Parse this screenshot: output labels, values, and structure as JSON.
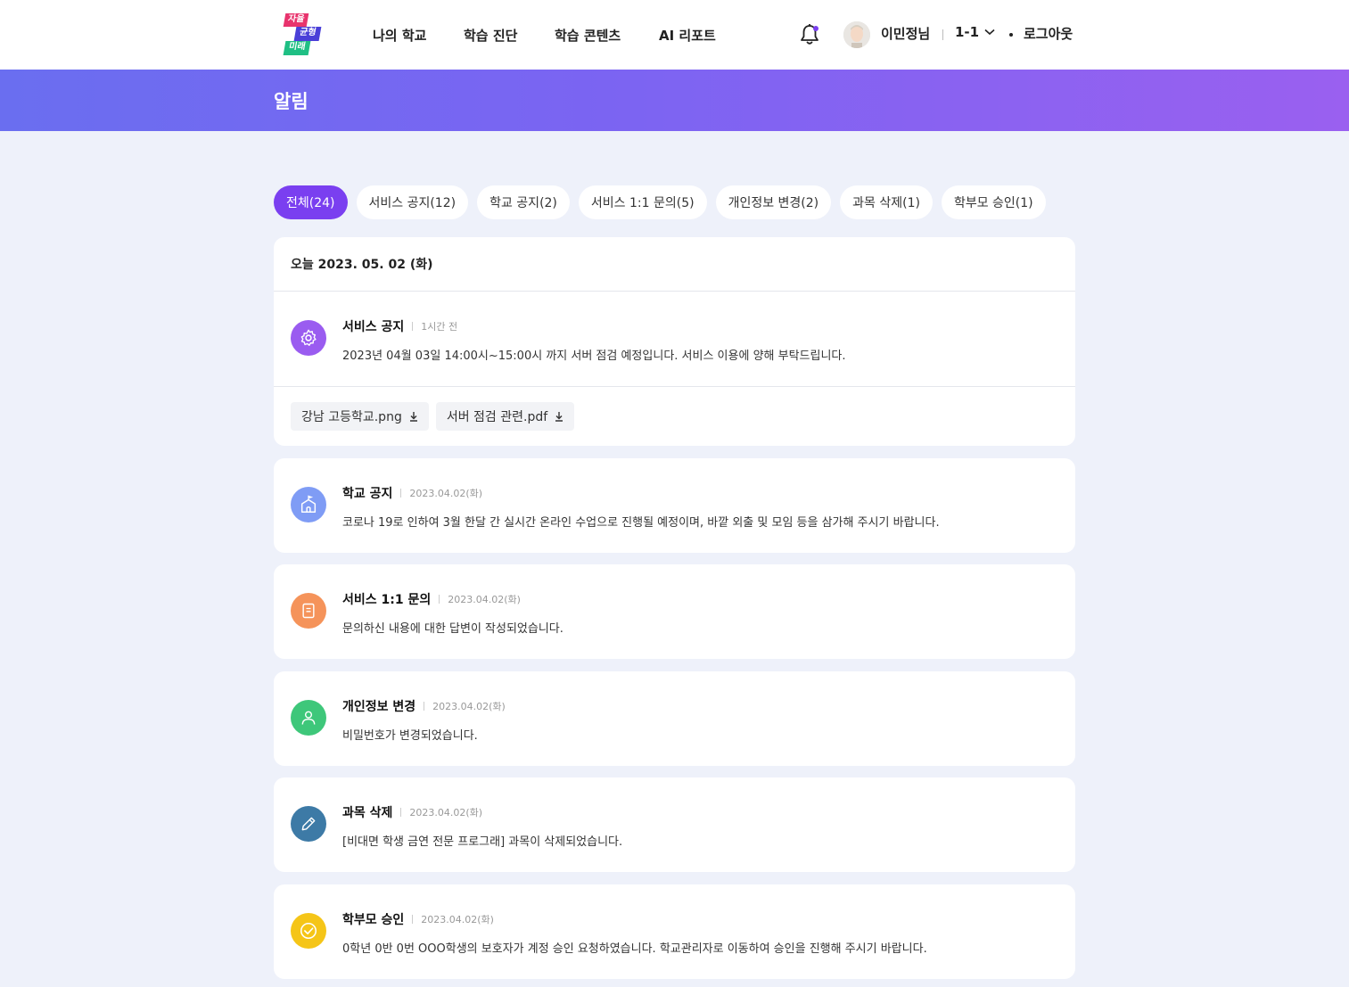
{
  "header": {
    "logo_lines": [
      "자율",
      "균형",
      "미래"
    ],
    "nav": [
      "나의 학교",
      "학습 진단",
      "학습 콘텐츠",
      "AI 리포트"
    ],
    "user_name": "이민정님",
    "class_label": "1-1",
    "logout_label": "로그아웃"
  },
  "page": {
    "title": "알림"
  },
  "filters": [
    {
      "label": "전체(24)",
      "active": true
    },
    {
      "label": "서비스 공지(12)",
      "active": false
    },
    {
      "label": "학교 공지(2)",
      "active": false
    },
    {
      "label": "서비스 1:1 문의(5)",
      "active": false
    },
    {
      "label": "개인정보 변경(2)",
      "active": false
    },
    {
      "label": "과목 삭제(1)",
      "active": false
    },
    {
      "label": "학부모 승인(1)",
      "active": false
    }
  ],
  "today": {
    "date_label": "오늘 2023. 05. 02 (화)"
  },
  "notices": [
    {
      "title": "서비스 공지",
      "time": "1시간 전",
      "body": "2023년 04월 03일 14:00시~15:00시 까지 서버 점검 예정입니다. 서비스 이용에 양해 부탁드립니다.",
      "icon": "gear-icon",
      "color": "#9a5cf0",
      "attachments": [
        "강남 고등학교.png",
        "서버 점검 관련.pdf"
      ]
    },
    {
      "title": "학교 공지",
      "time": "2023.04.02(화)",
      "body": "코로나 19로 인하여 3월 한달 간 실시간 온라인 수업으로 진행될 예정이며, 바깥 외출 및 모임 등을 삼가해 주시기 바랍니다.",
      "icon": "school-icon",
      "color": "#7f9cf5"
    },
    {
      "title": "서비스 1:1 문의",
      "time": "2023.04.02(화)",
      "body": "문의하신 내용에 대한 답변이 작성되었습니다.",
      "icon": "document-icon",
      "color": "#f5935a"
    },
    {
      "title": "개인정보 변경",
      "time": "2023.04.02(화)",
      "body": "비밀번호가 변경되었습니다.",
      "icon": "user-icon",
      "color": "#3ec77a"
    },
    {
      "title": "과목 삭제",
      "time": "2023.04.02(화)",
      "body": "[비대면 학생 금연 전문 프로그래] 과목이 삭제되었습니다.",
      "icon": "pencil-icon",
      "color": "#3d7aa6"
    },
    {
      "title": "학부모 승인",
      "time": "2023.04.02(화)",
      "body": "0학년 0반 0번 OOO학생의 보호자가 계정 승인 요청하였습니다. 학교관리자로 이동하여 승인을 진행해 주시기 바랍니다.",
      "icon": "check-circle-icon",
      "color": "#f5c518"
    }
  ]
}
